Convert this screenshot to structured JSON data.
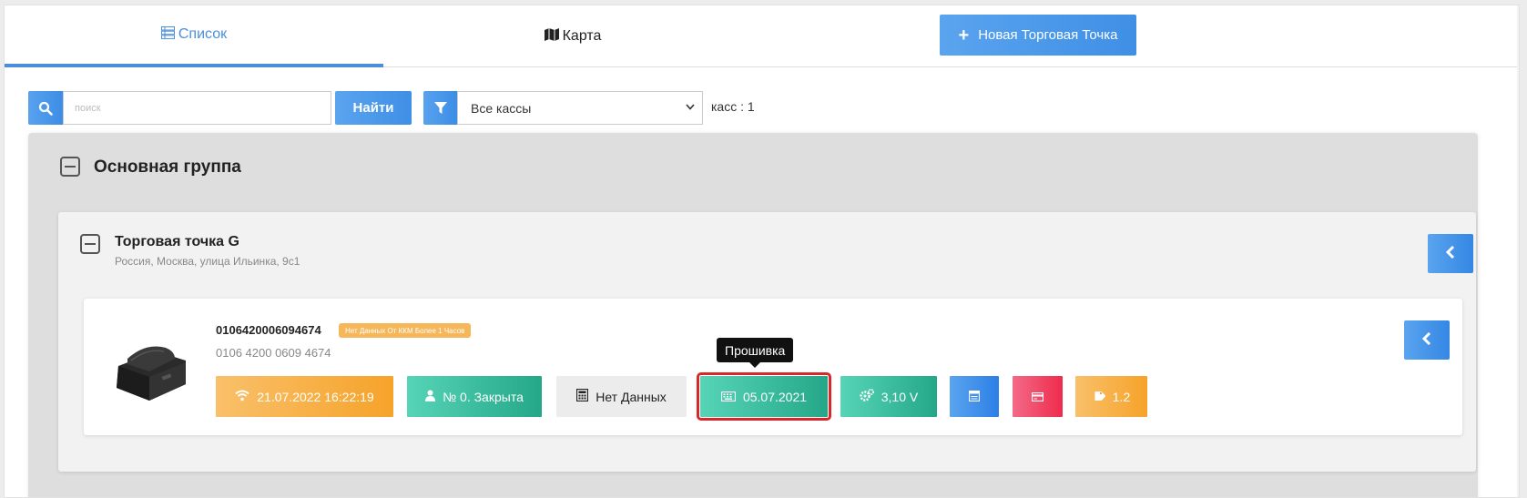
{
  "tabs": {
    "list_label": "Список",
    "map_label": "Карта",
    "new_point_label": "Новая Торговая Точка"
  },
  "search": {
    "placeholder": "поиск",
    "button_label": "Найти"
  },
  "filter": {
    "selected": "Все кассы",
    "count_text": "касс : 1"
  },
  "group": {
    "title": "Основная группа"
  },
  "store": {
    "name": "Торговая точка G",
    "address": "Россия, Москва, улица Ильинка, 9с1"
  },
  "device": {
    "serial": "0106420006094674",
    "warning": "Нет Данных От ККМ Более 1 Часов",
    "reg_number": "0106 4200 0609 4674",
    "chips": {
      "last_seen": "21.07.2022 16:22:19",
      "shift": "№ 0. Закрыта",
      "fiscal": "Нет Данных",
      "firmware_date": "05.07.2021",
      "voltage": "3,10 V",
      "version": "1.2"
    },
    "tooltip": "Прошивка"
  },
  "colors": {
    "accent_blue": "#4b8fd8",
    "orange": "#f6a32a",
    "teal": "#24a788",
    "red": "#ef2b4c",
    "highlight": "#d9262b"
  },
  "icons": {
    "list": "list-icon",
    "map": "map-icon",
    "plus": "plus-icon",
    "search": "search-icon",
    "filter": "filter-icon",
    "collapse": "chevron-left-icon",
    "wifi": "wifi-icon",
    "user": "user-icon",
    "calculator": "calculator-icon",
    "keyboard": "keyboard-icon",
    "gears": "gears-icon",
    "tag": "tag-icon"
  }
}
